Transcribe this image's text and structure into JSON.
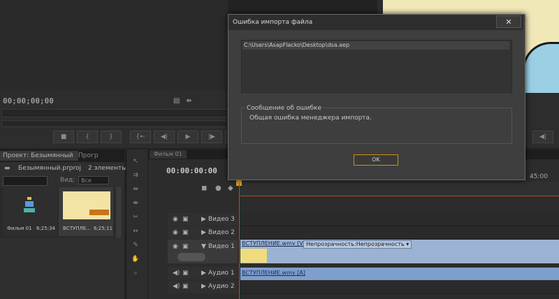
{
  "source_monitor": {
    "timecode": "00;00;00;00",
    "icons": [
      "film-icon",
      "transport-icons"
    ],
    "transport_buttons": [
      "■",
      "{",
      "}",
      "{←",
      "◀|",
      "▶",
      "|▶",
      "→}"
    ]
  },
  "program_monitor": {
    "transport_buttons": [
      "◀|",
      "▶"
    ]
  },
  "project_panel": {
    "tab_active": "Проект: Безымянный",
    "tab_other": "Прогр",
    "project_name": "Безымянный.prproj",
    "item_count": "2 элементы",
    "view_label": "Вид:",
    "view_value": "Все",
    "items": [
      {
        "name": "Фильм 01",
        "duration": "6;25;34"
      },
      {
        "name": "ВСТУПЛЕ...",
        "duration": "6;25;11"
      }
    ]
  },
  "timeline": {
    "tab": "Фильм 01",
    "timecode": "00:00:00:00",
    "ruler_label": "45:00",
    "tracks": [
      {
        "name": "Видео 3",
        "type": "video"
      },
      {
        "name": "Видео 2",
        "type": "video"
      },
      {
        "name": "Видео 1",
        "type": "video"
      },
      {
        "name": "Аудио 1",
        "type": "audio"
      },
      {
        "name": "Аудио 2",
        "type": "audio"
      }
    ],
    "video_clip": {
      "title": "ВСТУПЛЕНИЕ.wmv [V]",
      "effect": "Непрозрачность:Непрозрачность ▾"
    },
    "audio_clip": {
      "title": "ВСТУПЛЕНИЕ.wmv [A]"
    }
  },
  "dialog": {
    "title": "Ошибка импорта файла",
    "close_glyph": "✕",
    "file_path": "C:\\Users\\AsapFlacko\\Desktop\\dsa.aep",
    "error_group_label": "Сообщение об ошибке",
    "error_text": "Общая ошибка менеджера импорта.",
    "ok_label": "OK"
  },
  "colors": {
    "dialog_bg": "#3e3e3e",
    "ok_border": "#c8921a",
    "video_clip": "#9cb2d2",
    "audio_clip": "#7e9ecc",
    "playhead": "#d04020"
  }
}
